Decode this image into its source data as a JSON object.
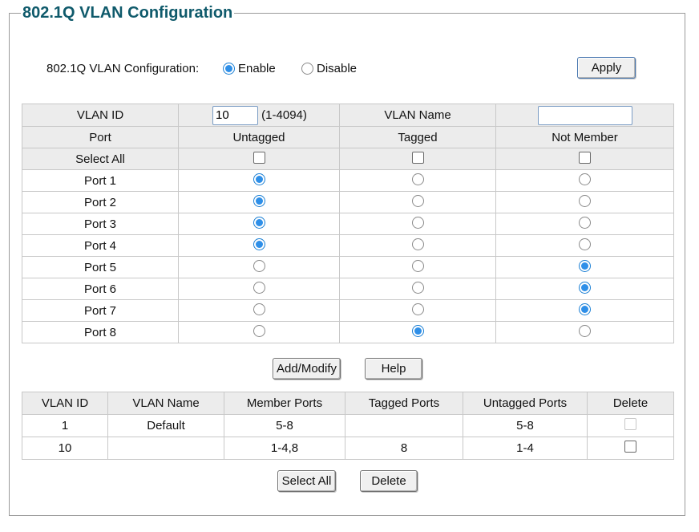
{
  "title": "802.1Q VLAN Configuration",
  "config": {
    "label": "802.1Q VLAN Configuration:",
    "enable_label": "Enable",
    "disable_label": "Disable",
    "selected": "enable",
    "apply_label": "Apply"
  },
  "editor": {
    "vlan_id_label": "VLAN ID",
    "vlan_id_value": "10",
    "vlan_id_range": "(1-4094)",
    "vlan_name_label": "VLAN Name",
    "vlan_name_value": "",
    "columns": [
      "Port",
      "Untagged",
      "Tagged",
      "Not Member"
    ],
    "select_all_label": "Select All",
    "ports": [
      {
        "name": "Port 1",
        "mode": "untagged"
      },
      {
        "name": "Port 2",
        "mode": "untagged"
      },
      {
        "name": "Port 3",
        "mode": "untagged"
      },
      {
        "name": "Port 4",
        "mode": "untagged"
      },
      {
        "name": "Port 5",
        "mode": "not_member"
      },
      {
        "name": "Port 6",
        "mode": "not_member"
      },
      {
        "name": "Port 7",
        "mode": "not_member"
      },
      {
        "name": "Port 8",
        "mode": "tagged"
      }
    ]
  },
  "actions": {
    "add_modify_label": "Add/Modify",
    "help_label": "Help"
  },
  "vlan_table": {
    "headers": [
      "VLAN ID",
      "VLAN Name",
      "Member Ports",
      "Tagged Ports",
      "Untagged Ports",
      "Delete"
    ],
    "rows": [
      {
        "vlan_id": "1",
        "vlan_name": "Default",
        "member_ports": "5-8",
        "tagged_ports": "",
        "untagged_ports": "5-8",
        "delete_disabled": true
      },
      {
        "vlan_id": "10",
        "vlan_name": "",
        "member_ports": "1-4,8",
        "tagged_ports": "8",
        "untagged_ports": "1-4",
        "delete_disabled": false
      }
    ]
  },
  "bottom_actions": {
    "select_all_label": "Select All",
    "delete_label": "Delete"
  },
  "colors": {
    "title": "#0f5a6b",
    "radio_selected": "#2e8fe8",
    "header_bg": "#ececec"
  }
}
